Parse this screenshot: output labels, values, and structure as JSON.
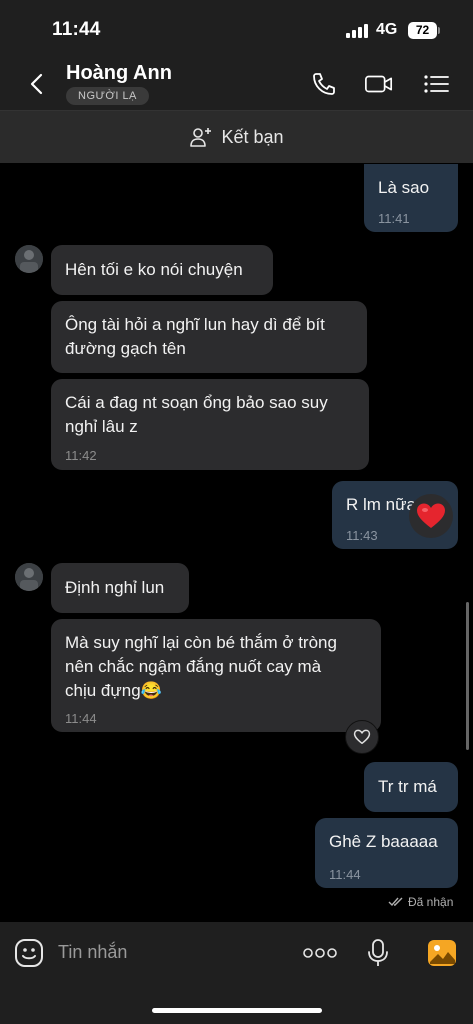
{
  "status_bar": {
    "time": "11:44",
    "network": "4G",
    "battery": "72"
  },
  "header": {
    "contact_name": "Hoàng Ann",
    "badge": "NGƯỜI LẠ"
  },
  "add_friend": {
    "label": "Kết bạn"
  },
  "messages": [
    {
      "dir": "out",
      "lines": [
        "Là sao"
      ],
      "time": "11:41"
    },
    {
      "dir": "in",
      "lines": [
        "Hên tối e ko nói chuyện"
      ]
    },
    {
      "dir": "in",
      "lines": [
        "Ông tài hỏi a nghĩ lun hay dì để bít",
        "đường gạch tên"
      ]
    },
    {
      "dir": "in",
      "lines": [
        "Cái a đag nt soạn ổng bảo sao suy",
        "nghỉ lâu z"
      ],
      "time": "11:42"
    },
    {
      "dir": "out",
      "lines": [
        "R lm nữa"
      ],
      "time": "11:43",
      "reaction": "heart"
    },
    {
      "dir": "in",
      "lines": [
        "Định nghỉ lun"
      ]
    },
    {
      "dir": "in",
      "lines": [
        "Mà suy nghĩ lại còn bé thắm ở tròng",
        "nên chắc ngậm đắng nuốt cay mà",
        "chịu đựng😂"
      ],
      "time": "11:44"
    },
    {
      "dir": "out",
      "lines": [
        "Tr tr má"
      ]
    },
    {
      "dir": "out",
      "lines": [
        "Ghê Z baaaaa"
      ],
      "time": "11:44"
    }
  ],
  "seen_status": "Đã nhận",
  "composer": {
    "placeholder": "Tin nhắn"
  },
  "colors": {
    "bubble_in": "#2c2c2e",
    "bubble_out": "#253445",
    "heart": "#e5252e",
    "gallery_icon": "#f5a623"
  }
}
